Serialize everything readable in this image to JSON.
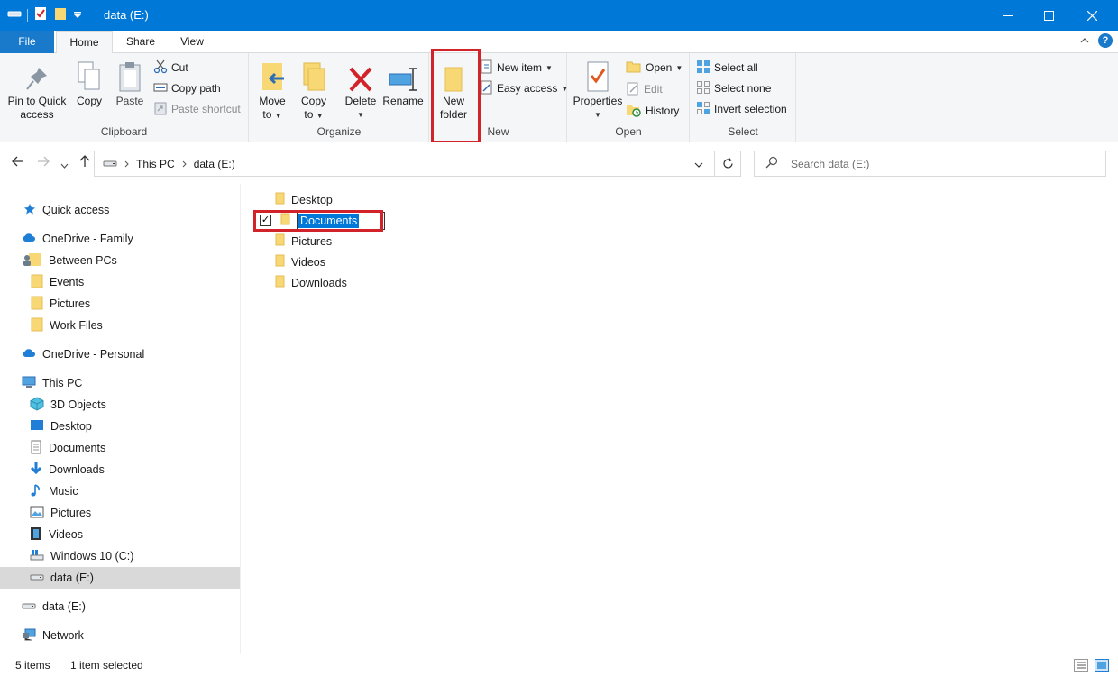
{
  "window": {
    "title": "data (E:)",
    "controls": {
      "minimize": "—",
      "maximize": "☐",
      "close": "✕"
    }
  },
  "ribbon_tabs": {
    "file": "File",
    "home": "Home",
    "share": "Share",
    "view": "View"
  },
  "ribbon": {
    "clipboard": {
      "label": "Clipboard",
      "pin": "Pin to Quick access",
      "copy": "Copy",
      "paste": "Paste",
      "cut": "Cut",
      "copy_path": "Copy path",
      "paste_shortcut": "Paste shortcut"
    },
    "organize": {
      "label": "Organize",
      "move_to": "Move to",
      "copy_to": "Copy to",
      "delete": "Delete",
      "rename": "Rename"
    },
    "new": {
      "label": "New",
      "new_folder": "New folder",
      "new_item": "New item",
      "easy_access": "Easy access"
    },
    "open": {
      "label": "Open",
      "properties": "Properties",
      "open": "Open",
      "edit": "Edit",
      "history": "History"
    },
    "select": {
      "label": "Select",
      "select_all": "Select all",
      "select_none": "Select none",
      "invert_selection": "Invert selection"
    }
  },
  "address_bar": {
    "crumbs": [
      "This PC",
      "data (E:)"
    ],
    "search_placeholder": "Search data (E:)"
  },
  "nav_pane": {
    "items": [
      {
        "label": "Quick access",
        "icon": "star-icon"
      },
      {
        "label": "OneDrive - Family",
        "icon": "cloud-icon"
      },
      {
        "label": "Between PCs",
        "icon": "shared-folder-icon"
      },
      {
        "label": "Events",
        "icon": "folder-icon"
      },
      {
        "label": "Pictures",
        "icon": "folder-icon"
      },
      {
        "label": "Work Files",
        "icon": "folder-icon"
      },
      {
        "label": "OneDrive - Personal",
        "icon": "cloud-icon"
      },
      {
        "label": "This PC",
        "icon": "computer-icon"
      },
      {
        "label": "3D Objects",
        "icon": "3d-objects-icon"
      },
      {
        "label": "Desktop",
        "icon": "desktop-icon"
      },
      {
        "label": "Documents",
        "icon": "documents-icon"
      },
      {
        "label": "Downloads",
        "icon": "download-icon"
      },
      {
        "label": "Music",
        "icon": "music-icon"
      },
      {
        "label": "Pictures",
        "icon": "pictures-icon"
      },
      {
        "label": "Videos",
        "icon": "videos-icon"
      },
      {
        "label": "Windows 10 (C:)",
        "icon": "windows-drive-icon"
      },
      {
        "label": "data (E:)",
        "icon": "drive-icon"
      },
      {
        "label": "data (E:)",
        "icon": "drive-icon"
      },
      {
        "label": "Network",
        "icon": "network-icon"
      }
    ]
  },
  "files": [
    {
      "name": "Desktop"
    },
    {
      "name": "Documents"
    },
    {
      "name": "Pictures"
    },
    {
      "name": "Videos"
    },
    {
      "name": "Downloads"
    }
  ],
  "status": {
    "item_count": "5 items",
    "selection": "1 item selected"
  },
  "colors": {
    "accent": "#0078d7",
    "highlight_box": "#d2232a",
    "folder": "#f8d775"
  }
}
